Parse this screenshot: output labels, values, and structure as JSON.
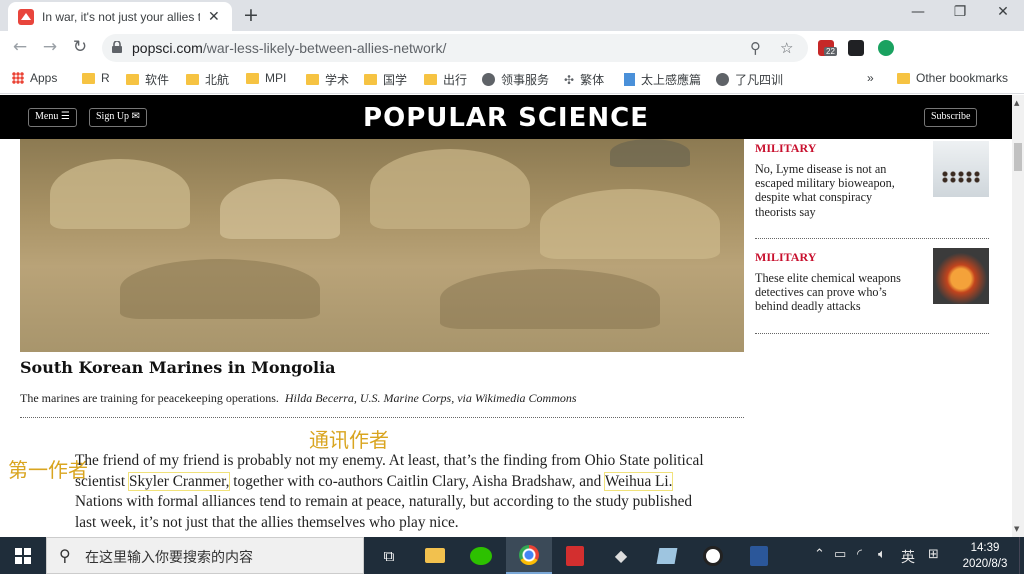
{
  "browser": {
    "tab_title": "In war, it's not just your allies t",
    "url_host": "popsci.com",
    "url_path": "/war-less-likely-between-allies-network/",
    "extension_badge": "22",
    "profile_initial": "W"
  },
  "bookmarks": {
    "apps": "Apps",
    "items": [
      "R",
      "软件",
      "北航",
      "MPI",
      "学术",
      "国学",
      "出行",
      "领事服务",
      "繁体",
      "太上感應篇",
      "了凡四训"
    ],
    "more": "»",
    "other": "Other bookmarks"
  },
  "site": {
    "menu": "Menu ☰",
    "signup": "Sign Up ✉",
    "brand": "POPULAR SCIENCE",
    "subscribe": "Subscribe"
  },
  "article": {
    "caption_title": "South Korean Marines in Mongolia",
    "caption_text": "The marines are training for peacekeeping operations.",
    "caption_credit": "Hilda Becerra, U.S. Marine Corps, via Wikimedia Commons",
    "para_1": "The friend of my friend is probably not my enemy. At least, that’s the finding from Ohio State political scientist ",
    "author_1": "Skyler Cranmer,",
    "para_2": " together with co-authors Caitlin Clary, Aisha Bradshaw, and ",
    "author_2": "Weihua Li.",
    "para_3": " Nations with formal alliances tend to remain at peace, naturally, but according to the study published last week, it’s not just that the allies themselves who play nice."
  },
  "annotations": {
    "corresponding": "通讯作者",
    "first": "第一作者"
  },
  "sidebar": [
    {
      "kicker": "MILITARY",
      "title": "No, Lyme disease is not an escaped military bioweapon, despite what conspiracy theorists say"
    },
    {
      "kicker": "MILITARY",
      "title": "These elite chemical weapons detectives can prove who’s behind deadly attacks"
    }
  ],
  "taskbar": {
    "search_placeholder": "在这里输入你要搜索的内容",
    "ime": "英",
    "time": "14:39",
    "date": "2020/8/3"
  },
  "colors": {
    "brand_bg": "#000000",
    "kicker": "#c8102e",
    "annotation": "#d9a520",
    "taskbar": "#1f2d3a"
  }
}
